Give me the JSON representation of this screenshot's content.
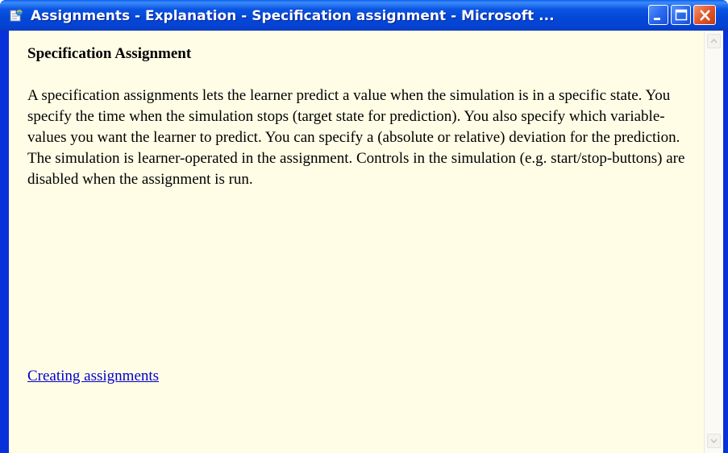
{
  "window": {
    "title": "Assignments - Explanation - Specification assignment - Microsoft ...",
    "colors": {
      "titlebar": "#0a55e4",
      "content_background": "#fffde6",
      "link": "#0000cc"
    }
  },
  "content": {
    "heading": "Specification Assignment",
    "paragraph": "A specification assignments lets the learner predict a value when the simulation is in a specific state. You specify the time when the simulation stops (target state for prediction). You also specify which variable-values you want the learner to predict. You can specify a (absolute or relative) deviation for the prediction. The simulation is learner-operated in the assignment. Controls in the simulation (e.g. start/stop-buttons) are disabled when the assignment is run.",
    "link_text": "Creating assignments"
  },
  "icons": {
    "app": "ie-page-icon",
    "minimize": "minimize-icon",
    "maximize": "maximize-icon",
    "close": "close-icon",
    "scroll_up": "scroll-up-arrow-icon",
    "scroll_down": "scroll-down-arrow-icon"
  }
}
